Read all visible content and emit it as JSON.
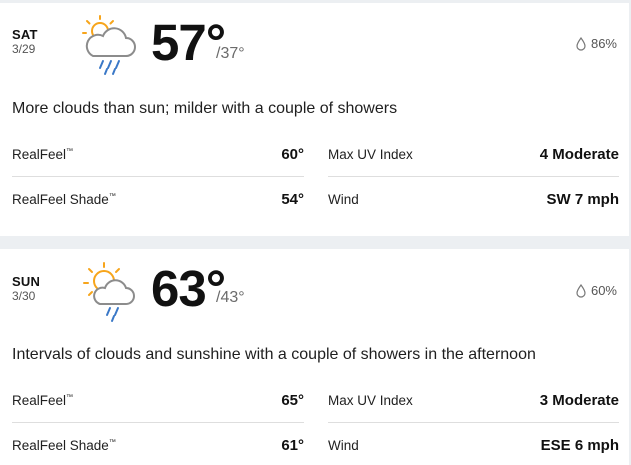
{
  "forecast": [
    {
      "day": "SAT",
      "date": "3/29",
      "icon": "partly-cloudy-showers-icon",
      "high": "57°",
      "low": "/37°",
      "precip": "86%",
      "phrase": "More clouds than sun; milder with a couple of showers",
      "realfeel_label": "RealFeel",
      "realfeel_tm": "™",
      "realfeel_value": "60°",
      "realfeel_shade_label": "RealFeel Shade",
      "realfeel_shade_tm": "™",
      "realfeel_shade_value": "54°",
      "uv_label": "Max UV Index",
      "uv_value": "4 Moderate",
      "wind_label": "Wind",
      "wind_value": "SW 7 mph"
    },
    {
      "day": "SUN",
      "date": "3/30",
      "icon": "partly-sunny-showers-icon",
      "high": "63°",
      "low": "/43°",
      "precip": "60%",
      "phrase": "Intervals of clouds and sunshine with a couple of showers in the afternoon",
      "realfeel_label": "RealFeel",
      "realfeel_tm": "™",
      "realfeel_value": "65°",
      "realfeel_shade_label": "RealFeel Shade",
      "realfeel_shade_tm": "™",
      "realfeel_shade_value": "61°",
      "uv_label": "Max UV Index",
      "uv_value": "3 Moderate",
      "wind_label": "Wind",
      "wind_value": "ESE 6 mph"
    }
  ],
  "colors": {
    "sun": "#f7a51b",
    "cloud_stroke": "#8c8c8c",
    "rain": "#3a78c7",
    "background": "#eceff2",
    "card": "#ffffff",
    "divider": "#dedede"
  }
}
